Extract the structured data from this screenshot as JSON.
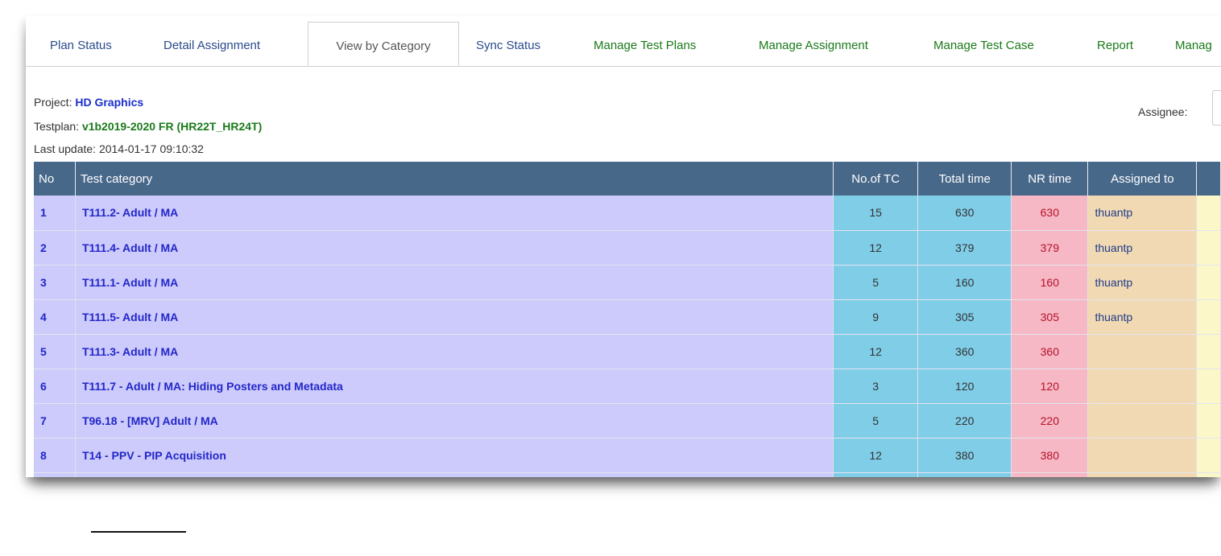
{
  "tabs": [
    {
      "label": "Plan Status",
      "color": "blue"
    },
    {
      "label": "Detail Assignment",
      "color": "blue"
    },
    {
      "label": "View by Category",
      "color": "active"
    },
    {
      "label": "Sync Status",
      "color": "blue"
    },
    {
      "label": "Manage Test Plans",
      "color": "green"
    },
    {
      "label": "Manage Assignment",
      "color": "green"
    },
    {
      "label": "Manage Test Case",
      "color": "green"
    },
    {
      "label": "Report",
      "color": "green"
    },
    {
      "label": "Manag",
      "color": "green"
    }
  ],
  "info": {
    "project_label": "Project:",
    "project_value": "HD Graphics",
    "testplan_label": "Testplan:",
    "testplan_value": "v1b2019-2020 FR (HR22T_HR24T)",
    "last_update": "Last update: 2014-01-17 09:10:32"
  },
  "filter": {
    "assignee_label": "Assignee:"
  },
  "table": {
    "headers": {
      "no": "No",
      "category": "Test category",
      "tc": "No.of TC",
      "total": "Total time",
      "nr": "NR time",
      "assigned": "Assigned to"
    },
    "rows": [
      {
        "no": "1",
        "category": "T111.2- Adult / MA",
        "tc": "15",
        "total": "630",
        "nr": "630",
        "assigned": "thuantp"
      },
      {
        "no": "2",
        "category": "T111.4- Adult / MA",
        "tc": "12",
        "total": "379",
        "nr": "379",
        "assigned": "thuantp"
      },
      {
        "no": "3",
        "category": "T111.1- Adult / MA",
        "tc": "5",
        "total": "160",
        "nr": "160",
        "assigned": "thuantp"
      },
      {
        "no": "4",
        "category": "T111.5- Adult / MA",
        "tc": "9",
        "total": "305",
        "nr": "305",
        "assigned": "thuantp"
      },
      {
        "no": "5",
        "category": "T111.3- Adult / MA",
        "tc": "12",
        "total": "360",
        "nr": "360",
        "assigned": ""
      },
      {
        "no": "6",
        "category": "T111.7 - Adult / MA: Hiding Posters and Metadata",
        "tc": "3",
        "total": "120",
        "nr": "120",
        "assigned": ""
      },
      {
        "no": "7",
        "category": "T96.18 - [MRV] Adult / MA",
        "tc": "5",
        "total": "220",
        "nr": "220",
        "assigned": ""
      },
      {
        "no": "8",
        "category": "T14 - PPV - PIP Acquisition",
        "tc": "12",
        "total": "380",
        "nr": "380",
        "assigned": ""
      }
    ]
  },
  "colors": {
    "header_bg": "#48688a",
    "category_bg": "#cccbfb",
    "count_bg": "#80cde8",
    "nr_bg": "#f5b8c4",
    "assigned_bg": "#f1dab3",
    "link_green": "#1a7a1a",
    "link_blue": "#2a4a8c"
  }
}
